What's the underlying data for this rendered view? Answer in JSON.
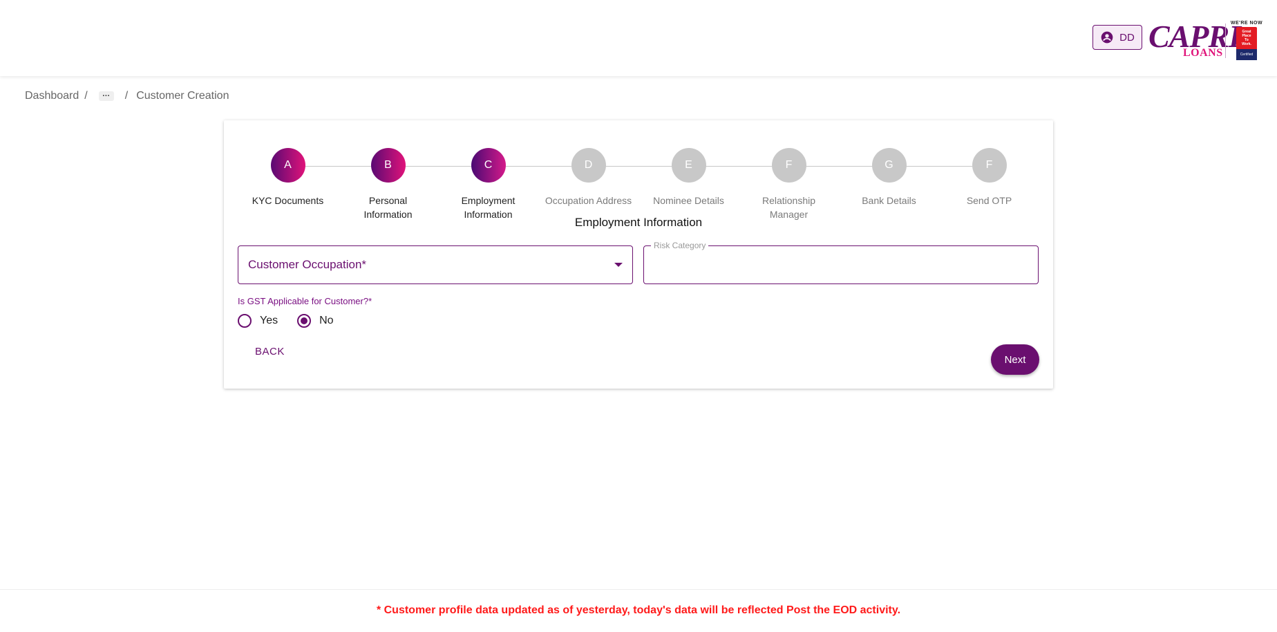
{
  "header": {
    "user_initials": "DD",
    "logo_text": "CAPRI",
    "logo_subtext": "LOANS",
    "badge_top": "WE'RE NOW",
    "badge_lines": [
      "Great",
      "Place",
      "To",
      "Work."
    ],
    "badge_bottom": "Certified",
    "brand_color": "#6a0f6f"
  },
  "breadcrumb": {
    "items": [
      "Dashboard",
      "...",
      "Customer Creation"
    ],
    "separator": "/"
  },
  "stepper": {
    "steps": [
      {
        "letter": "A",
        "label": "KYC Documents",
        "state": "done"
      },
      {
        "letter": "B",
        "label": "Personal Information",
        "state": "done"
      },
      {
        "letter": "C",
        "label": "Employment Information",
        "state": "current"
      },
      {
        "letter": "D",
        "label": "Occupation Address",
        "state": "pending"
      },
      {
        "letter": "E",
        "label": "Nominee Details",
        "state": "pending"
      },
      {
        "letter": "F",
        "label": "Relationship Manager",
        "state": "pending"
      },
      {
        "letter": "G",
        "label": "Bank Details",
        "state": "pending"
      },
      {
        "letter": "F",
        "label": "Send OTP",
        "state": "pending"
      }
    ]
  },
  "form": {
    "section_title": "Employment Information",
    "customer_occupation_placeholder": "Customer Occupation*",
    "risk_category_label": "Risk Category",
    "risk_category_value": "",
    "gst_question": "Is GST Applicable for Customer?*",
    "gst_options": [
      "Yes",
      "No"
    ],
    "gst_selected": "No",
    "back_label": "BACK",
    "next_label": "Next"
  },
  "footer": {
    "notice": "* Customer profile data updated as of yesterday, today's data will be reflected Post the EOD activity.",
    "notice_color": "#ff1a1a"
  }
}
